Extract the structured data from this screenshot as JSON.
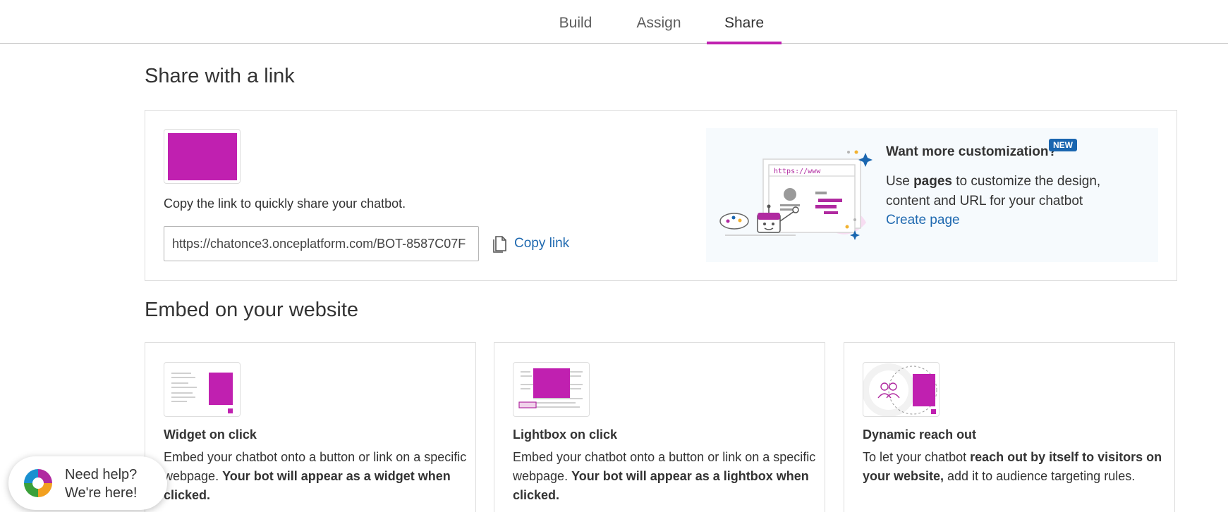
{
  "tabs": [
    {
      "label": "Build",
      "active": false
    },
    {
      "label": "Assign",
      "active": false
    },
    {
      "label": "Share",
      "active": true
    }
  ],
  "share": {
    "heading": "Share with a link",
    "description": "Copy the link to quickly share your chatbot.",
    "link_value": "https://chatonce3.onceplatform.com/BOT-8587C07F",
    "copy_label": "Copy link"
  },
  "promo": {
    "title": "Want more customization?",
    "badge": "NEW",
    "body_pre": "Use ",
    "body_bold": "pages",
    "body_post": " to customize the design, content and URL for your chatbot",
    "link": "Create page",
    "illustration_url_text": "https://www"
  },
  "embed": {
    "heading": "Embed on your website",
    "cards": [
      {
        "title": "Widget on click",
        "desc_pre": "Embed your chatbot onto a button or link on a specific webpage. ",
        "desc_bold": "Your bot will appear as a widget when clicked.",
        "desc_post": ""
      },
      {
        "title": "Lightbox on click",
        "desc_pre": "Embed your chatbot onto a button or link on a specific webpage. ",
        "desc_bold": "Your bot will appear as a lightbox when clicked.",
        "desc_post": ""
      },
      {
        "title": "Dynamic reach out",
        "desc_pre": "To let your chatbot ",
        "desc_bold": "reach out by itself to visitors on your website,",
        "desc_post": " add it to audience targeting rules."
      }
    ]
  },
  "help": {
    "line1": "Need help?",
    "line2": "We're here!"
  },
  "colors": {
    "accent": "#c020b0",
    "link": "#1f69b0",
    "badge": "#1a66b0"
  }
}
